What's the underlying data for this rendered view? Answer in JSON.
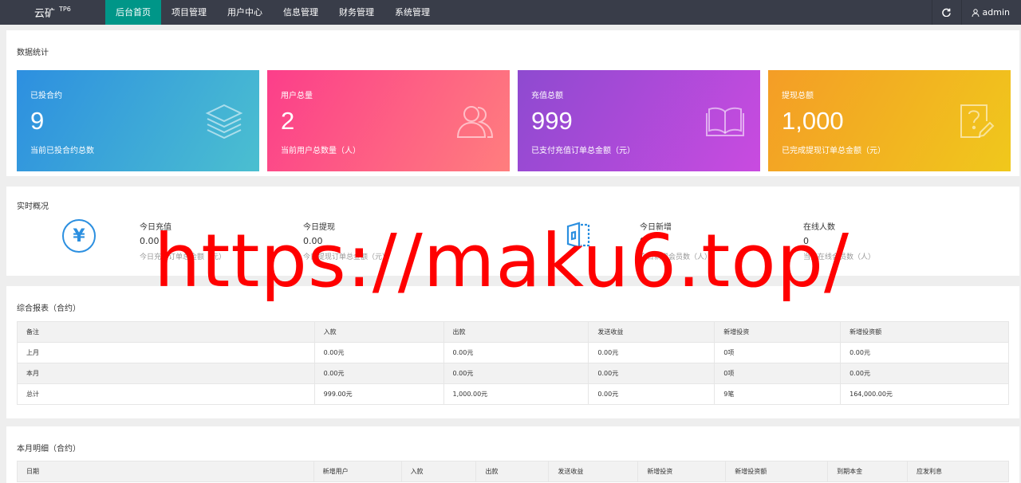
{
  "header": {
    "logo": "云矿",
    "logo_sup": "TP6",
    "nav": [
      "后台首页",
      "项目管理",
      "用户中心",
      "信息管理",
      "财务管理",
      "系统管理"
    ],
    "refresh_icon": "refresh-icon",
    "user": "admin"
  },
  "stats": {
    "title": "数据统计",
    "cards": [
      {
        "label": "已投合约",
        "value": "9",
        "desc": "当前已投合约总数",
        "icon": "layers-icon"
      },
      {
        "label": "用户总量",
        "value": "2",
        "desc": "当前用户总数量（人）",
        "icon": "users-icon"
      },
      {
        "label": "充值总额",
        "value": "999",
        "desc": "已支付充值订单总金额（元）",
        "icon": "book-icon"
      },
      {
        "label": "提现总额",
        "value": "1,000",
        "desc": "已完成提现订单总金额（元）",
        "icon": "question-edit-icon"
      }
    ]
  },
  "realtime": {
    "title": "实时概况",
    "items": [
      {
        "label": "今日充值",
        "value": "0.00",
        "desc": "今日充值订单总金额（元）"
      },
      {
        "label": "今日提现",
        "value": "0.00",
        "desc": "今日提现订单总金额（元）"
      },
      {
        "label": "今日新增",
        "value": "0",
        "desc": "今日新增会员数（人）"
      },
      {
        "label": "在线人数",
        "value": "0",
        "desc": "当前在线会员数（人）"
      }
    ]
  },
  "report": {
    "title": "综合报表（合约）",
    "headers": [
      "备注",
      "入款",
      "出款",
      "发送收益",
      "新增投资",
      "新增投资额"
    ],
    "rows": [
      [
        "上月",
        "0.00元",
        "0.00元",
        "0.00元",
        "0项",
        "0.00元"
      ],
      [
        "本月",
        "0.00元",
        "0.00元",
        "0.00元",
        "0项",
        "0.00元"
      ],
      [
        "总计",
        "999.00元",
        "1,000.00元",
        "0.00元",
        "9笔",
        "164,000.00元"
      ]
    ]
  },
  "monthly": {
    "title": "本月明细（合约）",
    "headers": [
      "日期",
      "新增用户",
      "入款",
      "出款",
      "发送收益",
      "新增投资",
      "新增投资额",
      "到期本金",
      "应发利息"
    ]
  },
  "watermark": "https://maku6.top/"
}
